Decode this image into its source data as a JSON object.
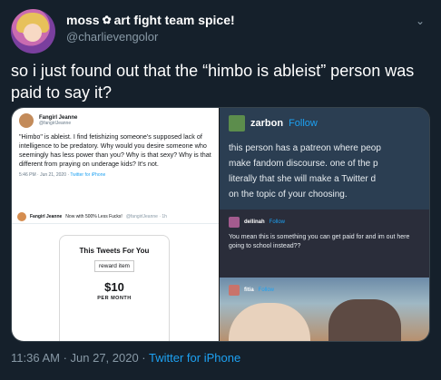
{
  "header": {
    "display_name": "moss",
    "name_suffix": "art fight team spice!",
    "handle": "@charlievengolor"
  },
  "tweet": {
    "text": "so i just found out that the “himbo is ableist” person was paid to say it?"
  },
  "media": {
    "left_tweet": {
      "name": "Fangirl Jeanne",
      "handle": "@fangirlJeanne",
      "body": "\"Himbo\" is ableist. I find fetishizing someone's supposed lack of intelligence to be predatory. Why would you desire someone who seemingly has less power than you? Why is that sexy? Why is that different from praying on underage kids? It's not.",
      "time": "5:46 PM · Jun 21, 2020 ·",
      "source": "Twitter for iPhone"
    },
    "left_patreon": {
      "bar_name": "Fangirl Jeanne",
      "bar_suffix": "Now with 500% Less Fucks!",
      "bar_handle": "@fangirlJeanne · 1h",
      "title": "This Tweets For You",
      "reward": "reward item",
      "price": "$10",
      "period": "PER MONTH"
    },
    "right_tumblr": {
      "username": "zarbon",
      "follow": "Follow",
      "post_lines": [
        "this person has a patreon where peop",
        "make fandom discourse. one of the p",
        "literally that she will make a Twitter d",
        "on the topic of your choosing."
      ],
      "reply_user": "dellinah",
      "reply_follow": "Follow",
      "reply_text": "You mean this is something you can get paid for and im out here going to school instead??",
      "third_user": "fitia",
      "third_follow": "Follow"
    }
  },
  "footer": {
    "timestamp": "11:36 AM · Jun 27, 2020 ·",
    "source": "Twitter for iPhone"
  }
}
